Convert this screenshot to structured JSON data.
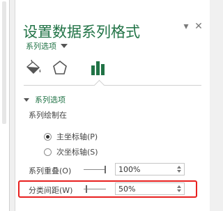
{
  "panel": {
    "title": "设置数据系列格式",
    "options_dropdown_label": "系列选项",
    "tabs": [
      {
        "name": "填充与线条",
        "icon": "paint-bucket-icon"
      },
      {
        "name": "效果",
        "icon": "pentagon-icon"
      },
      {
        "name": "系列选项",
        "icon": "bar-chart-icon",
        "selected": true
      }
    ],
    "section_title": "系列选项",
    "plot_series_on_label": "系列绘制在",
    "axis_options": [
      {
        "label": "主坐标轴(P)",
        "checked": true
      },
      {
        "label": "次坐标轴(S)",
        "checked": false
      }
    ],
    "series_overlap": {
      "label": "系列重叠(O)",
      "value": "100%",
      "level": 1.0
    },
    "gap_width": {
      "label": "分类间距(W)",
      "value": "50%",
      "level": 0.1
    }
  },
  "colors": {
    "accent_green": "#217346",
    "highlight_red": "#e8201f"
  }
}
